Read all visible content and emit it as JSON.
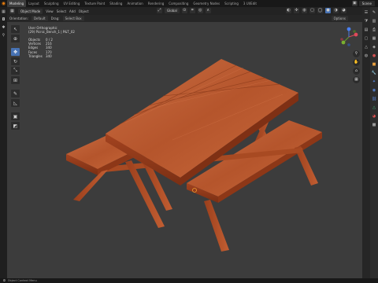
{
  "topbar": {
    "workspaces": [
      "Modeling",
      "Layout",
      "Sculpting",
      "UV Editing",
      "Texture Paint",
      "Shading",
      "Animation",
      "Rendering",
      "Compositing",
      "Geometry Nodes",
      "Scripting",
      "3 UI/Edit"
    ],
    "active_index": 0,
    "scene_label": "Scene"
  },
  "header": {
    "mode": "Object Mode",
    "menus": [
      "View",
      "Select",
      "Add",
      "Object"
    ],
    "transform": "Global"
  },
  "subheader": {
    "orientation_label": "Orientation:",
    "orientation": "Default",
    "drag_label": "Drag:",
    "drag": "Select Box",
    "options": "Options"
  },
  "overlay": {
    "view_name": "User Orthographic",
    "object_name": "(29) Picnic_Bench_1 | P&T_02",
    "stats": [
      {
        "label": "Objects",
        "value": "0 / 2"
      },
      {
        "label": "Vertices",
        "value": "216"
      },
      {
        "label": "Edges",
        "value": "340"
      },
      {
        "label": "Faces",
        "value": "170"
      },
      {
        "label": "Triangles",
        "value": "340"
      }
    ]
  },
  "statusbar": {
    "hint": "Object Context Menu"
  },
  "colors": {
    "accent": "#4772b3",
    "viewport_bg": "#3c3c3c",
    "wood_light": "#c8693f",
    "wood_dark": "#8e3a1d"
  }
}
